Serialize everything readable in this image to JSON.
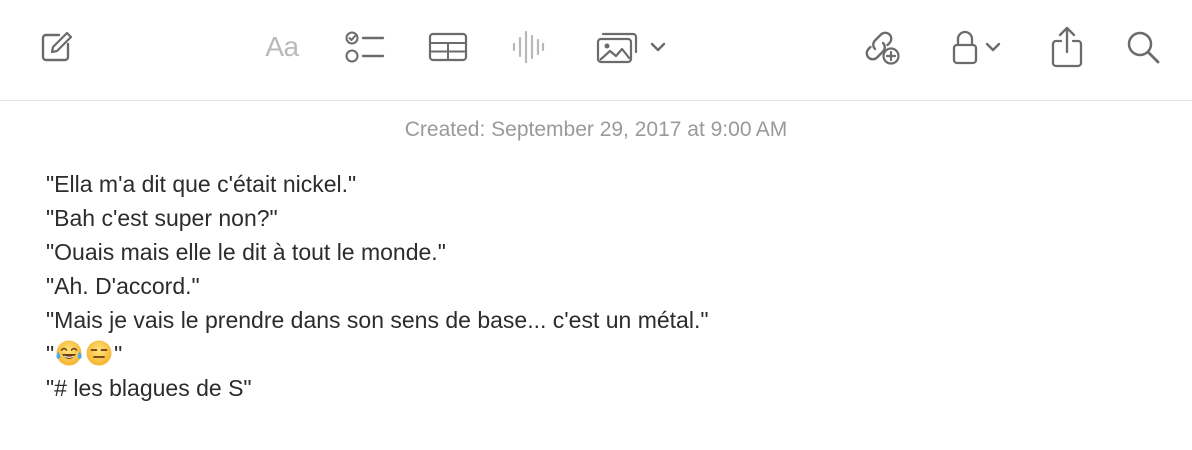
{
  "toolbar": {
    "items": [
      {
        "id": "compose",
        "icon": "compose-icon"
      },
      {
        "id": "format",
        "icon": "format-icon",
        "label": "Aa"
      },
      {
        "id": "checklist",
        "icon": "checklist-icon"
      },
      {
        "id": "table",
        "icon": "table-icon"
      },
      {
        "id": "audio",
        "icon": "audio-waveform-icon"
      },
      {
        "id": "media",
        "icon": "photo-gallery-icon"
      },
      {
        "id": "collaborate",
        "icon": "collaborate-link-icon"
      },
      {
        "id": "lock",
        "icon": "lock-icon"
      },
      {
        "id": "share",
        "icon": "share-icon"
      },
      {
        "id": "search",
        "icon": "search-icon"
      }
    ],
    "colors": {
      "icon": "#6b6b6b",
      "icon_disabled": "#b9b9b9"
    }
  },
  "note": {
    "created": "Created: September 29, 2017 at 9:00 AM",
    "lines": [
      "\"Ella m'a dit que c'était nickel.\"",
      "\"Bah c'est super non?\"",
      "\"Ouais mais elle le dit à tout le monde.\"",
      "\"Ah. D'accord.\"",
      "\"Mais je vais le prendre dans son sens de base... c'est un métal.\"",
      {
        "quote_open": "\"",
        "emojis": [
          "face-with-tears-of-joy",
          "expressionless-face"
        ],
        "quote_close": "\""
      },
      "\"# les blagues de S\""
    ]
  }
}
